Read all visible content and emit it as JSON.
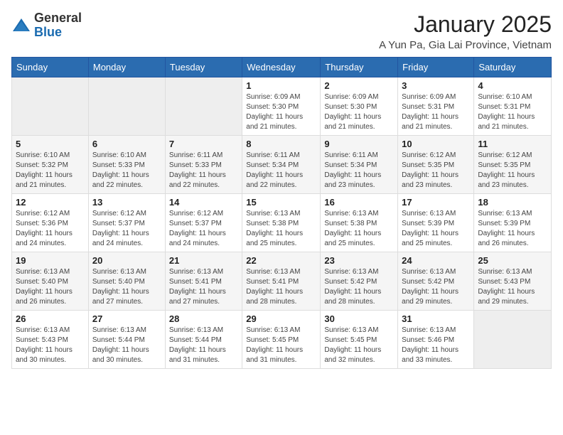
{
  "logo": {
    "general": "General",
    "blue": "Blue"
  },
  "header": {
    "month": "January 2025",
    "location": "A Yun Pa, Gia Lai Province, Vietnam"
  },
  "weekdays": [
    "Sunday",
    "Monday",
    "Tuesday",
    "Wednesday",
    "Thursday",
    "Friday",
    "Saturday"
  ],
  "weeks": [
    [
      {
        "num": "",
        "info": ""
      },
      {
        "num": "",
        "info": ""
      },
      {
        "num": "",
        "info": ""
      },
      {
        "num": "1",
        "info": "Sunrise: 6:09 AM\nSunset: 5:30 PM\nDaylight: 11 hours\nand 21 minutes."
      },
      {
        "num": "2",
        "info": "Sunrise: 6:09 AM\nSunset: 5:30 PM\nDaylight: 11 hours\nand 21 minutes."
      },
      {
        "num": "3",
        "info": "Sunrise: 6:09 AM\nSunset: 5:31 PM\nDaylight: 11 hours\nand 21 minutes."
      },
      {
        "num": "4",
        "info": "Sunrise: 6:10 AM\nSunset: 5:31 PM\nDaylight: 11 hours\nand 21 minutes."
      }
    ],
    [
      {
        "num": "5",
        "info": "Sunrise: 6:10 AM\nSunset: 5:32 PM\nDaylight: 11 hours\nand 21 minutes."
      },
      {
        "num": "6",
        "info": "Sunrise: 6:10 AM\nSunset: 5:33 PM\nDaylight: 11 hours\nand 22 minutes."
      },
      {
        "num": "7",
        "info": "Sunrise: 6:11 AM\nSunset: 5:33 PM\nDaylight: 11 hours\nand 22 minutes."
      },
      {
        "num": "8",
        "info": "Sunrise: 6:11 AM\nSunset: 5:34 PM\nDaylight: 11 hours\nand 22 minutes."
      },
      {
        "num": "9",
        "info": "Sunrise: 6:11 AM\nSunset: 5:34 PM\nDaylight: 11 hours\nand 23 minutes."
      },
      {
        "num": "10",
        "info": "Sunrise: 6:12 AM\nSunset: 5:35 PM\nDaylight: 11 hours\nand 23 minutes."
      },
      {
        "num": "11",
        "info": "Sunrise: 6:12 AM\nSunset: 5:35 PM\nDaylight: 11 hours\nand 23 minutes."
      }
    ],
    [
      {
        "num": "12",
        "info": "Sunrise: 6:12 AM\nSunset: 5:36 PM\nDaylight: 11 hours\nand 24 minutes."
      },
      {
        "num": "13",
        "info": "Sunrise: 6:12 AM\nSunset: 5:37 PM\nDaylight: 11 hours\nand 24 minutes."
      },
      {
        "num": "14",
        "info": "Sunrise: 6:12 AM\nSunset: 5:37 PM\nDaylight: 11 hours\nand 24 minutes."
      },
      {
        "num": "15",
        "info": "Sunrise: 6:13 AM\nSunset: 5:38 PM\nDaylight: 11 hours\nand 25 minutes."
      },
      {
        "num": "16",
        "info": "Sunrise: 6:13 AM\nSunset: 5:38 PM\nDaylight: 11 hours\nand 25 minutes."
      },
      {
        "num": "17",
        "info": "Sunrise: 6:13 AM\nSunset: 5:39 PM\nDaylight: 11 hours\nand 25 minutes."
      },
      {
        "num": "18",
        "info": "Sunrise: 6:13 AM\nSunset: 5:39 PM\nDaylight: 11 hours\nand 26 minutes."
      }
    ],
    [
      {
        "num": "19",
        "info": "Sunrise: 6:13 AM\nSunset: 5:40 PM\nDaylight: 11 hours\nand 26 minutes."
      },
      {
        "num": "20",
        "info": "Sunrise: 6:13 AM\nSunset: 5:40 PM\nDaylight: 11 hours\nand 27 minutes."
      },
      {
        "num": "21",
        "info": "Sunrise: 6:13 AM\nSunset: 5:41 PM\nDaylight: 11 hours\nand 27 minutes."
      },
      {
        "num": "22",
        "info": "Sunrise: 6:13 AM\nSunset: 5:41 PM\nDaylight: 11 hours\nand 28 minutes."
      },
      {
        "num": "23",
        "info": "Sunrise: 6:13 AM\nSunset: 5:42 PM\nDaylight: 11 hours\nand 28 minutes."
      },
      {
        "num": "24",
        "info": "Sunrise: 6:13 AM\nSunset: 5:42 PM\nDaylight: 11 hours\nand 29 minutes."
      },
      {
        "num": "25",
        "info": "Sunrise: 6:13 AM\nSunset: 5:43 PM\nDaylight: 11 hours\nand 29 minutes."
      }
    ],
    [
      {
        "num": "26",
        "info": "Sunrise: 6:13 AM\nSunset: 5:43 PM\nDaylight: 11 hours\nand 30 minutes."
      },
      {
        "num": "27",
        "info": "Sunrise: 6:13 AM\nSunset: 5:44 PM\nDaylight: 11 hours\nand 30 minutes."
      },
      {
        "num": "28",
        "info": "Sunrise: 6:13 AM\nSunset: 5:44 PM\nDaylight: 11 hours\nand 31 minutes."
      },
      {
        "num": "29",
        "info": "Sunrise: 6:13 AM\nSunset: 5:45 PM\nDaylight: 11 hours\nand 31 minutes."
      },
      {
        "num": "30",
        "info": "Sunrise: 6:13 AM\nSunset: 5:45 PM\nDaylight: 11 hours\nand 32 minutes."
      },
      {
        "num": "31",
        "info": "Sunrise: 6:13 AM\nSunset: 5:46 PM\nDaylight: 11 hours\nand 33 minutes."
      },
      {
        "num": "",
        "info": ""
      }
    ]
  ]
}
